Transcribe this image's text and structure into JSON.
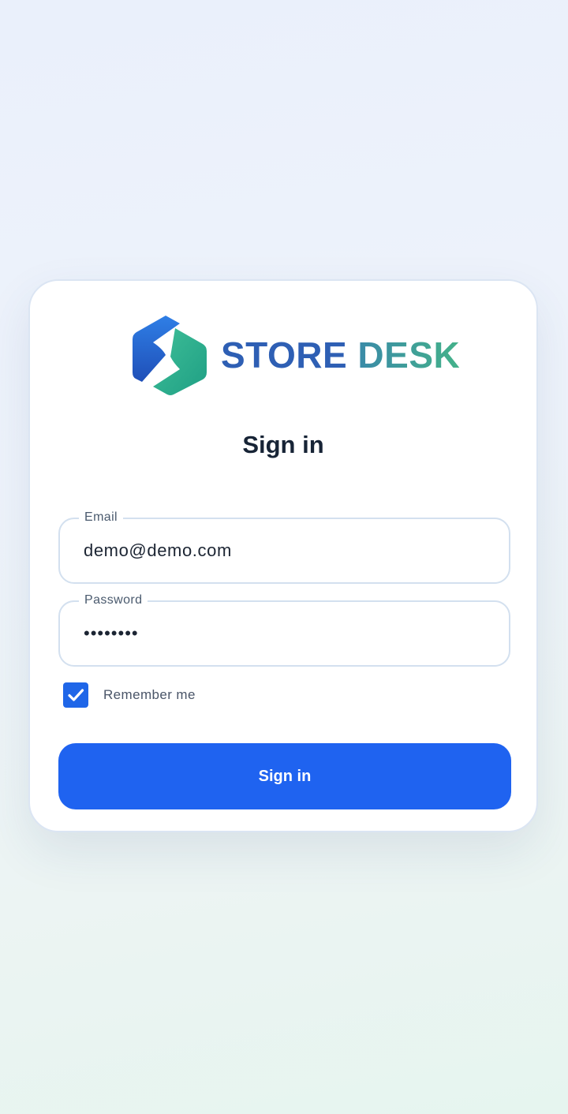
{
  "brand": {
    "name_part1": "STORE",
    "name_part2": "DESK",
    "logo_icon": "hexagon-s-logo-icon",
    "colors": {
      "store": "#2e5fb4",
      "desk_start": "#3a8aa8",
      "desk_end": "#44b28a"
    }
  },
  "form": {
    "title": "Sign in",
    "email": {
      "label": "Email",
      "value": "demo@demo.com"
    },
    "password": {
      "label": "Password",
      "value": "••••••••"
    },
    "remember": {
      "label": "Remember me",
      "checked": true,
      "icon": "checkmark-icon"
    },
    "submit_label": "Sign in"
  },
  "colors": {
    "primary": "#1f63f0",
    "heading": "#172436",
    "field_border": "#d3e0ef"
  }
}
